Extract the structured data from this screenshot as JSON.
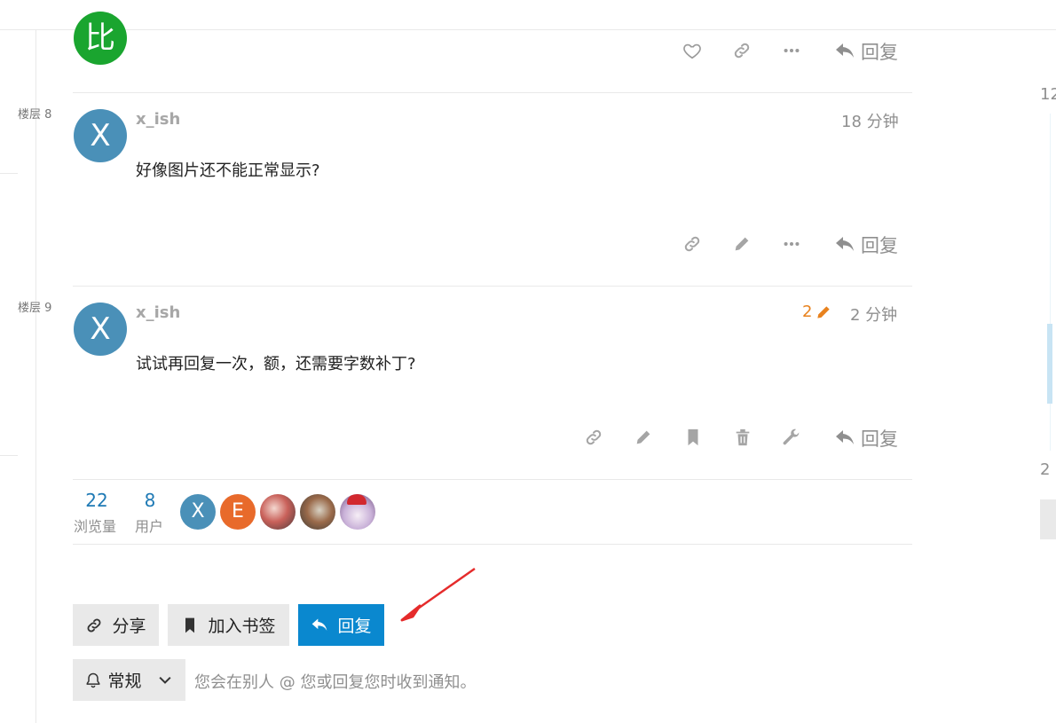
{
  "floors": {
    "floor8": "楼层 8",
    "floor9": "楼层 9"
  },
  "prev_post": {
    "avatar_letter": "比",
    "avatar_color": "#1aa52f",
    "reply_label": "回复"
  },
  "posts": [
    {
      "username": "x_ish",
      "avatar_letter": "X",
      "time": "18 分钟",
      "text": "好像图片还不能正常显示?",
      "reply_label": "回复"
    },
    {
      "username": "x_ish",
      "avatar_letter": "X",
      "edit_count": "2",
      "time": "2 分钟",
      "text": "试试再回复一次，额，还需要字数补丁?",
      "reply_label": "回复"
    }
  ],
  "stats": {
    "views": "22",
    "views_label": "浏览量",
    "users": "8",
    "users_label": "用户",
    "participants": [
      {
        "letter": "X",
        "color": "#4a90b8"
      },
      {
        "letter": "E",
        "color": "#e86a2b"
      }
    ]
  },
  "footer": {
    "share_label": "分享",
    "bookmark_label": "加入书签",
    "reply_label": "回复",
    "notification_level": "常规",
    "notification_text": "您会在别人 @ 您或回复您时收到通知。"
  },
  "timeline": {
    "top_number_partial": "12",
    "bottom_number_partial": "2"
  },
  "colors": {
    "accent": "#0a88cf",
    "edit_orange": "#e8821e",
    "annotation_arrow": "#e52b2b"
  }
}
